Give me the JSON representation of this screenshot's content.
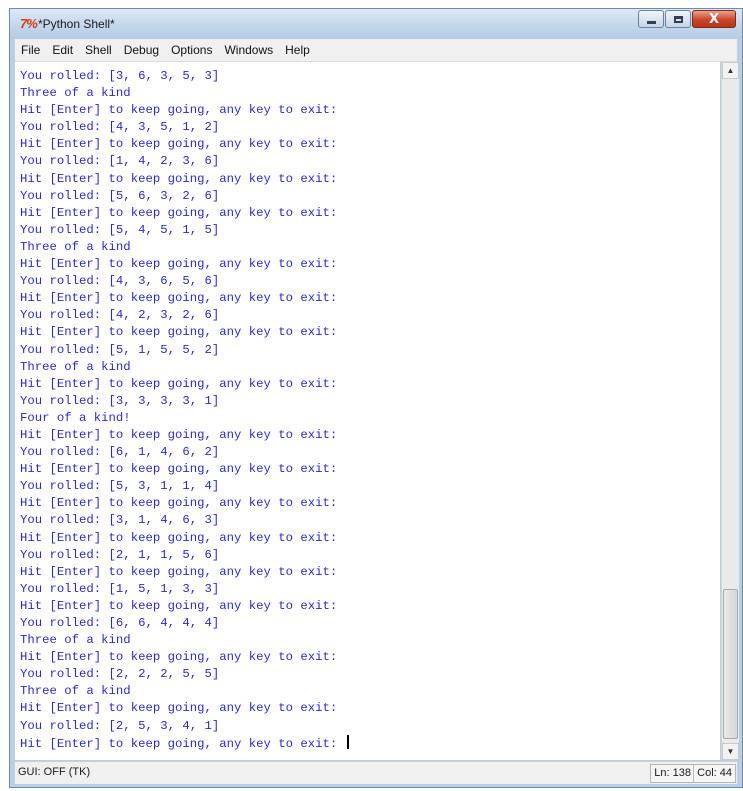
{
  "window": {
    "title": "*Python Shell*",
    "icon": "7%",
    "controls": {
      "minimize": "minimize-icon",
      "maximize": "maximize-icon",
      "close": "X"
    }
  },
  "menu": [
    "File",
    "Edit",
    "Shell",
    "Debug",
    "Options",
    "Windows",
    "Help"
  ],
  "shell_lines": [
    "You rolled: [3, 6, 3, 5, 3]",
    "Three of a kind",
    "Hit [Enter] to keep going, any key to exit:",
    "You rolled: [4, 3, 5, 1, 2]",
    "Hit [Enter] to keep going, any key to exit:",
    "You rolled: [1, 4, 2, 3, 6]",
    "Hit [Enter] to keep going, any key to exit:",
    "You rolled: [5, 6, 3, 2, 6]",
    "Hit [Enter] to keep going, any key to exit:",
    "You rolled: [5, 4, 5, 1, 5]",
    "Three of a kind",
    "Hit [Enter] to keep going, any key to exit:",
    "You rolled: [4, 3, 6, 5, 6]",
    "Hit [Enter] to keep going, any key to exit:",
    "You rolled: [4, 2, 3, 2, 6]",
    "Hit [Enter] to keep going, any key to exit:",
    "You rolled: [5, 1, 5, 5, 2]",
    "Three of a kind",
    "Hit [Enter] to keep going, any key to exit:",
    "You rolled: [3, 3, 3, 3, 1]",
    "Four of a kind!",
    "Hit [Enter] to keep going, any key to exit:",
    "You rolled: [6, 1, 4, 6, 2]",
    "Hit [Enter] to keep going, any key to exit:",
    "You rolled: [5, 3, 1, 1, 4]",
    "Hit [Enter] to keep going, any key to exit:",
    "You rolled: [3, 1, 4, 6, 3]",
    "Hit [Enter] to keep going, any key to exit:",
    "You rolled: [2, 1, 1, 5, 6]",
    "Hit [Enter] to keep going, any key to exit:",
    "You rolled: [1, 5, 1, 3, 3]",
    "Hit [Enter] to keep going, any key to exit:",
    "You rolled: [6, 6, 4, 4, 4]",
    "Three of a kind",
    "Hit [Enter] to keep going, any key to exit:",
    "You rolled: [2, 2, 2, 5, 5]",
    "Three of a kind",
    "Hit [Enter] to keep going, any key to exit:",
    "You rolled: [2, 5, 3, 4, 1]",
    "Hit [Enter] to keep going, any key to exit: "
  ],
  "status": {
    "left": "GUI: OFF (TK)",
    "line": "Ln: 138",
    "col": "Col: 44"
  },
  "colors": {
    "output_text": "#2a2ad2",
    "title_bar": "#c3d7ec",
    "close_button": "#c8462b"
  }
}
